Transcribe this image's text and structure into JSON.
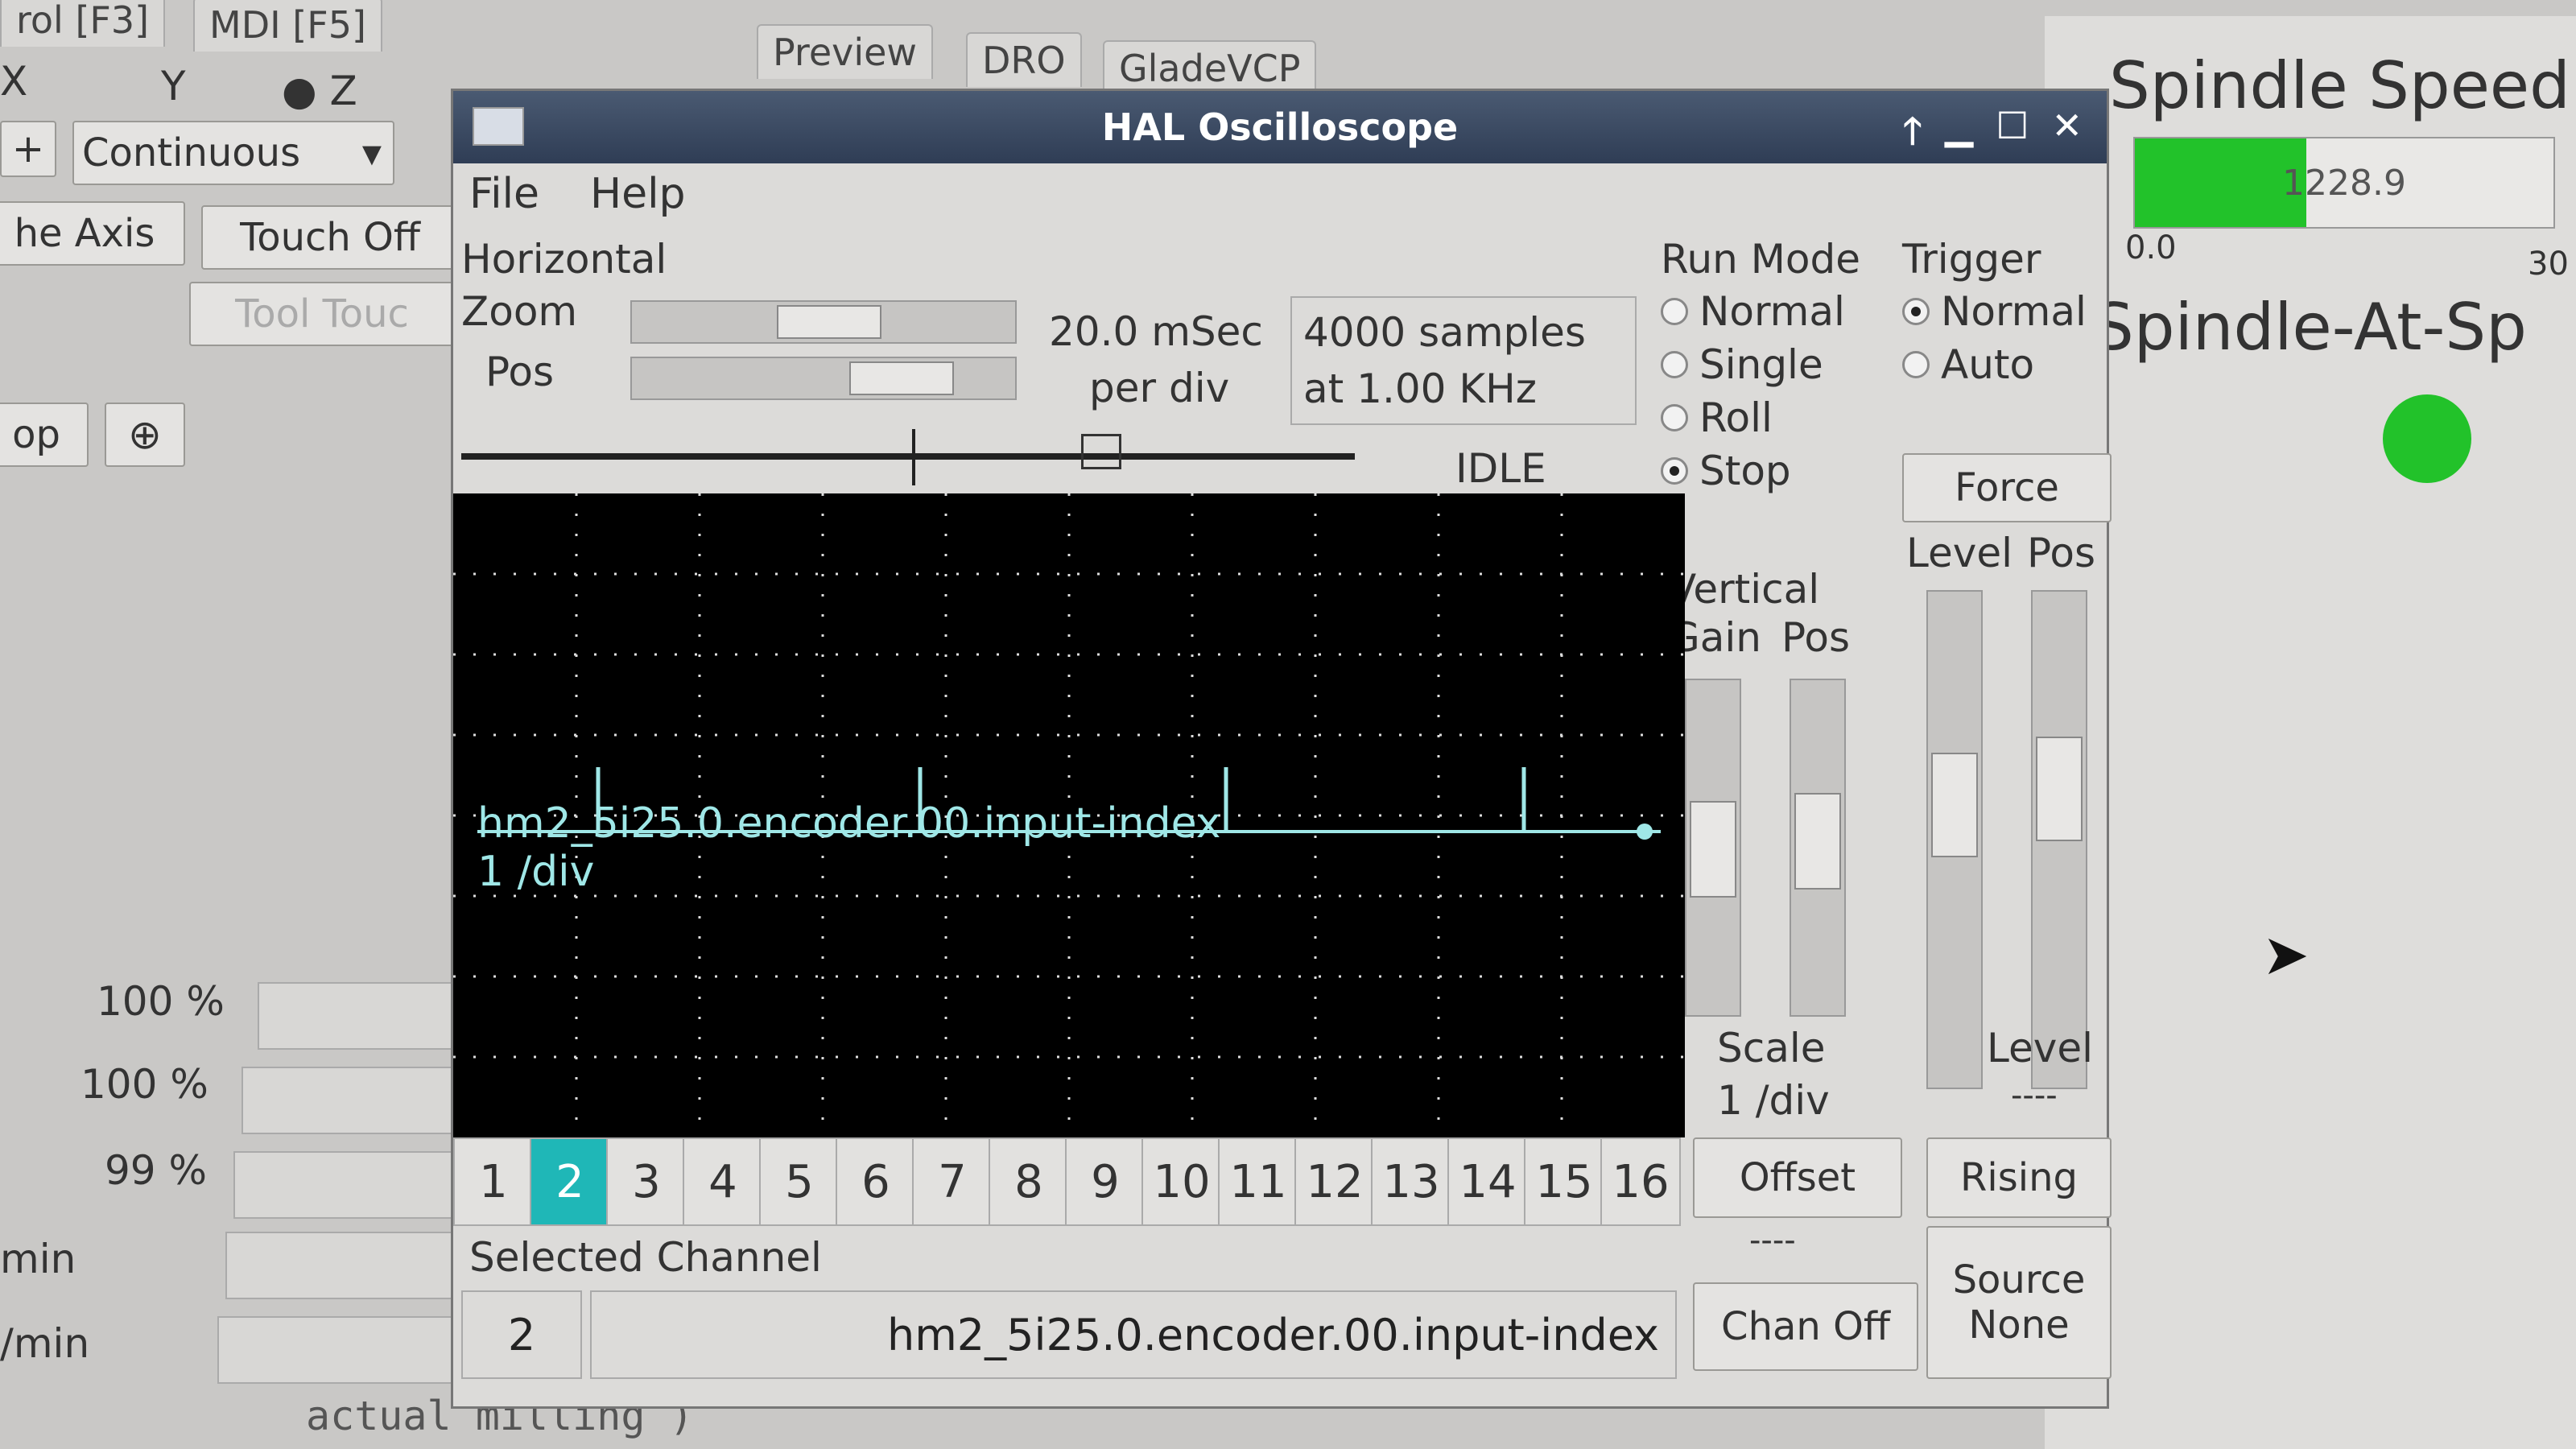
{
  "background": {
    "tabs_top": [
      "rol [F3]",
      "MDI [F5]"
    ],
    "axis_radios": [
      "X",
      "Y",
      "Z"
    ],
    "jog_mode": "Continuous",
    "home_axis": "he Axis",
    "touch_off": "Touch Off",
    "tool_touch": "Tool Touc",
    "stop_label": "op",
    "preview_tabs": [
      "Preview",
      "DRO",
      "GladeVCP"
    ],
    "overrides": [
      "100 %",
      "100 %",
      "99 %"
    ],
    "units": [
      "min",
      "/min"
    ],
    "bottom_text": "actual milling )",
    "spindle_speed_title": "Spindle Speed",
    "spindle_value": "1228.9",
    "spindle_value_fraction": 0.41,
    "spindle_min": "0.0",
    "spindle_max": "30",
    "spindle_at_speed": "Spindle-At-Sp",
    "led_color": "#22c22a"
  },
  "scope": {
    "title": "HAL Oscilloscope",
    "menu": [
      "File",
      "Help"
    ],
    "horizontal": {
      "section": "Horizontal",
      "zoom_label": "Zoom",
      "pos_label": "Pos",
      "time_per_div": "20.0 mSec",
      "per_div": "per div",
      "samples": "4000 samples",
      "rate": "at 1.00 KHz",
      "state": "IDLE"
    },
    "run_mode": {
      "title": "Run Mode",
      "options": [
        "Normal",
        "Single",
        "Roll",
        "Stop"
      ],
      "selected": "Stop"
    },
    "trigger": {
      "title": "Trigger",
      "options": [
        "Normal",
        "Auto"
      ],
      "selected": "Normal",
      "force": "Force",
      "level_label": "Level",
      "pos_label": "Pos",
      "level_value_label": "Level",
      "level_value": "----",
      "edge": "Rising",
      "source_label": "Source",
      "source_value": "None"
    },
    "vertical": {
      "title": "Vertical",
      "gain_label": "Gain",
      "pos_label": "Pos",
      "scale_label": "Scale",
      "scale_value": "1 /div",
      "offset_label": "Offset",
      "offset_value": "----",
      "chan_off": "Chan Off"
    },
    "trace": {
      "signal": "hm2_5i25.0.encoder.00.input-index",
      "scale": "1 /div",
      "color": "#9fe7e7"
    },
    "channels": [
      "1",
      "2",
      "3",
      "4",
      "5",
      "6",
      "7",
      "8",
      "9",
      "10",
      "11",
      "12",
      "13",
      "14",
      "15",
      "16"
    ],
    "selected_channel": "2",
    "selected_channel_label": "Selected Channel",
    "selected_channel_number": "2",
    "selected_channel_signal": "hm2_5i25.0.encoder.00.input-index"
  }
}
